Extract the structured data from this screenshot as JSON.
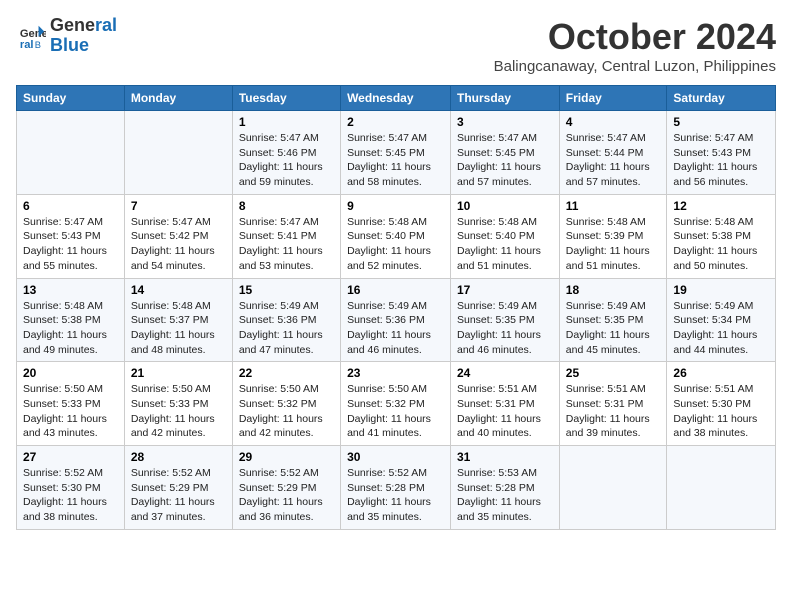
{
  "logo": {
    "line1": "General",
    "line2": "Blue"
  },
  "title": "October 2024",
  "location": "Balingcanaway, Central Luzon, Philippines",
  "headers": [
    "Sunday",
    "Monday",
    "Tuesday",
    "Wednesday",
    "Thursday",
    "Friday",
    "Saturday"
  ],
  "weeks": [
    [
      {
        "day": "",
        "sunrise": "",
        "sunset": "",
        "daylight": ""
      },
      {
        "day": "",
        "sunrise": "",
        "sunset": "",
        "daylight": ""
      },
      {
        "day": "1",
        "sunrise": "Sunrise: 5:47 AM",
        "sunset": "Sunset: 5:46 PM",
        "daylight": "Daylight: 11 hours and 59 minutes."
      },
      {
        "day": "2",
        "sunrise": "Sunrise: 5:47 AM",
        "sunset": "Sunset: 5:45 PM",
        "daylight": "Daylight: 11 hours and 58 minutes."
      },
      {
        "day": "3",
        "sunrise": "Sunrise: 5:47 AM",
        "sunset": "Sunset: 5:45 PM",
        "daylight": "Daylight: 11 hours and 57 minutes."
      },
      {
        "day": "4",
        "sunrise": "Sunrise: 5:47 AM",
        "sunset": "Sunset: 5:44 PM",
        "daylight": "Daylight: 11 hours and 57 minutes."
      },
      {
        "day": "5",
        "sunrise": "Sunrise: 5:47 AM",
        "sunset": "Sunset: 5:43 PM",
        "daylight": "Daylight: 11 hours and 56 minutes."
      }
    ],
    [
      {
        "day": "6",
        "sunrise": "Sunrise: 5:47 AM",
        "sunset": "Sunset: 5:43 PM",
        "daylight": "Daylight: 11 hours and 55 minutes."
      },
      {
        "day": "7",
        "sunrise": "Sunrise: 5:47 AM",
        "sunset": "Sunset: 5:42 PM",
        "daylight": "Daylight: 11 hours and 54 minutes."
      },
      {
        "day": "8",
        "sunrise": "Sunrise: 5:47 AM",
        "sunset": "Sunset: 5:41 PM",
        "daylight": "Daylight: 11 hours and 53 minutes."
      },
      {
        "day": "9",
        "sunrise": "Sunrise: 5:48 AM",
        "sunset": "Sunset: 5:40 PM",
        "daylight": "Daylight: 11 hours and 52 minutes."
      },
      {
        "day": "10",
        "sunrise": "Sunrise: 5:48 AM",
        "sunset": "Sunset: 5:40 PM",
        "daylight": "Daylight: 11 hours and 51 minutes."
      },
      {
        "day": "11",
        "sunrise": "Sunrise: 5:48 AM",
        "sunset": "Sunset: 5:39 PM",
        "daylight": "Daylight: 11 hours and 51 minutes."
      },
      {
        "day": "12",
        "sunrise": "Sunrise: 5:48 AM",
        "sunset": "Sunset: 5:38 PM",
        "daylight": "Daylight: 11 hours and 50 minutes."
      }
    ],
    [
      {
        "day": "13",
        "sunrise": "Sunrise: 5:48 AM",
        "sunset": "Sunset: 5:38 PM",
        "daylight": "Daylight: 11 hours and 49 minutes."
      },
      {
        "day": "14",
        "sunrise": "Sunrise: 5:48 AM",
        "sunset": "Sunset: 5:37 PM",
        "daylight": "Daylight: 11 hours and 48 minutes."
      },
      {
        "day": "15",
        "sunrise": "Sunrise: 5:49 AM",
        "sunset": "Sunset: 5:36 PM",
        "daylight": "Daylight: 11 hours and 47 minutes."
      },
      {
        "day": "16",
        "sunrise": "Sunrise: 5:49 AM",
        "sunset": "Sunset: 5:36 PM",
        "daylight": "Daylight: 11 hours and 46 minutes."
      },
      {
        "day": "17",
        "sunrise": "Sunrise: 5:49 AM",
        "sunset": "Sunset: 5:35 PM",
        "daylight": "Daylight: 11 hours and 46 minutes."
      },
      {
        "day": "18",
        "sunrise": "Sunrise: 5:49 AM",
        "sunset": "Sunset: 5:35 PM",
        "daylight": "Daylight: 11 hours and 45 minutes."
      },
      {
        "day": "19",
        "sunrise": "Sunrise: 5:49 AM",
        "sunset": "Sunset: 5:34 PM",
        "daylight": "Daylight: 11 hours and 44 minutes."
      }
    ],
    [
      {
        "day": "20",
        "sunrise": "Sunrise: 5:50 AM",
        "sunset": "Sunset: 5:33 PM",
        "daylight": "Daylight: 11 hours and 43 minutes."
      },
      {
        "day": "21",
        "sunrise": "Sunrise: 5:50 AM",
        "sunset": "Sunset: 5:33 PM",
        "daylight": "Daylight: 11 hours and 42 minutes."
      },
      {
        "day": "22",
        "sunrise": "Sunrise: 5:50 AM",
        "sunset": "Sunset: 5:32 PM",
        "daylight": "Daylight: 11 hours and 42 minutes."
      },
      {
        "day": "23",
        "sunrise": "Sunrise: 5:50 AM",
        "sunset": "Sunset: 5:32 PM",
        "daylight": "Daylight: 11 hours and 41 minutes."
      },
      {
        "day": "24",
        "sunrise": "Sunrise: 5:51 AM",
        "sunset": "Sunset: 5:31 PM",
        "daylight": "Daylight: 11 hours and 40 minutes."
      },
      {
        "day": "25",
        "sunrise": "Sunrise: 5:51 AM",
        "sunset": "Sunset: 5:31 PM",
        "daylight": "Daylight: 11 hours and 39 minutes."
      },
      {
        "day": "26",
        "sunrise": "Sunrise: 5:51 AM",
        "sunset": "Sunset: 5:30 PM",
        "daylight": "Daylight: 11 hours and 38 minutes."
      }
    ],
    [
      {
        "day": "27",
        "sunrise": "Sunrise: 5:52 AM",
        "sunset": "Sunset: 5:30 PM",
        "daylight": "Daylight: 11 hours and 38 minutes."
      },
      {
        "day": "28",
        "sunrise": "Sunrise: 5:52 AM",
        "sunset": "Sunset: 5:29 PM",
        "daylight": "Daylight: 11 hours and 37 minutes."
      },
      {
        "day": "29",
        "sunrise": "Sunrise: 5:52 AM",
        "sunset": "Sunset: 5:29 PM",
        "daylight": "Daylight: 11 hours and 36 minutes."
      },
      {
        "day": "30",
        "sunrise": "Sunrise: 5:52 AM",
        "sunset": "Sunset: 5:28 PM",
        "daylight": "Daylight: 11 hours and 35 minutes."
      },
      {
        "day": "31",
        "sunrise": "Sunrise: 5:53 AM",
        "sunset": "Sunset: 5:28 PM",
        "daylight": "Daylight: 11 hours and 35 minutes."
      },
      {
        "day": "",
        "sunrise": "",
        "sunset": "",
        "daylight": ""
      },
      {
        "day": "",
        "sunrise": "",
        "sunset": "",
        "daylight": ""
      }
    ]
  ]
}
